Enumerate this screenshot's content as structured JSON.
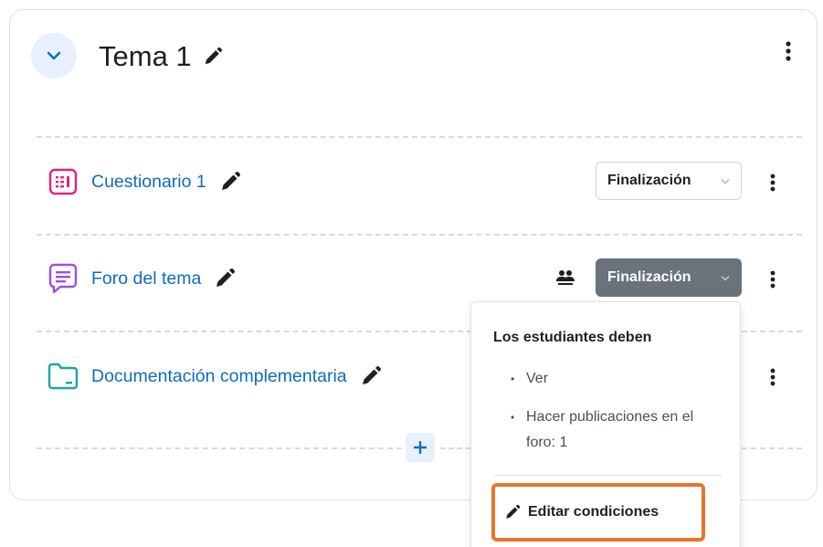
{
  "section": {
    "title": "Tema 1"
  },
  "activities": [
    {
      "name": "Cuestionario 1",
      "completion_label": "Finalización"
    },
    {
      "name": "Foro del tema",
      "completion_label": "Finalización"
    },
    {
      "name": "Documentación complementaria"
    }
  ],
  "popover": {
    "title": "Los estudiantes deben",
    "conditions": [
      "Ver",
      "Hacer publicaciones en el foro: 1"
    ],
    "edit_label": "Editar condiciones"
  },
  "colors": {
    "link": "#0f6cbf",
    "quiz_icon": "#e2237e",
    "forum_icon": "#9b4ee8",
    "folder_icon": "#1aa7a0",
    "highlight": "#e8742a",
    "dark_button": "#6a737b"
  },
  "icons": {
    "collapse": "chevron-down-icon",
    "edit": "pencil-icon",
    "menu": "kebab-menu-icon",
    "quiz": "quiz-icon",
    "forum": "forum-icon",
    "folder": "folder-icon",
    "groups": "groups-icon",
    "add": "plus-icon"
  }
}
